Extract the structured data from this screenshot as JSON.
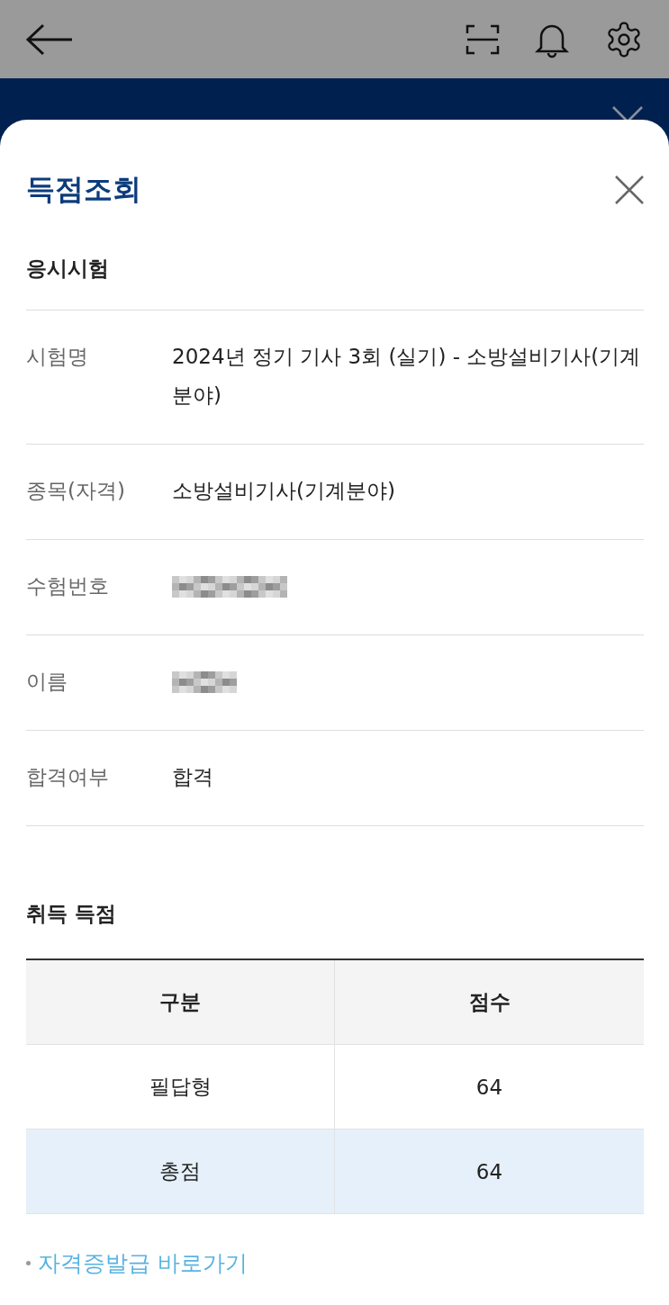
{
  "sheet": {
    "title": "득점조회",
    "exam_section": {
      "heading": "응시시험",
      "rows": [
        {
          "kind": "text",
          "label": "시험명",
          "value": "2024년 정기 기사 3회 (실기) - 소방설비기사(기계분야)"
        },
        {
          "kind": "text",
          "label": "종목(자격)",
          "value": "소방설비기사(기계분야)"
        },
        {
          "kind": "redacted",
          "label": "수험번호"
        },
        {
          "kind": "redacted",
          "label": "이름"
        },
        {
          "kind": "text",
          "label": "합격여부",
          "value": "합격"
        }
      ]
    },
    "score_section": {
      "heading": "취득 득점",
      "columns": [
        "구분",
        "점수"
      ],
      "rows": [
        {
          "cells": [
            "필답형",
            "64"
          ],
          "highlighted": false
        },
        {
          "cells": [
            "총점",
            "64"
          ],
          "highlighted": true
        }
      ]
    },
    "link": "자격증발급 바로가기"
  }
}
